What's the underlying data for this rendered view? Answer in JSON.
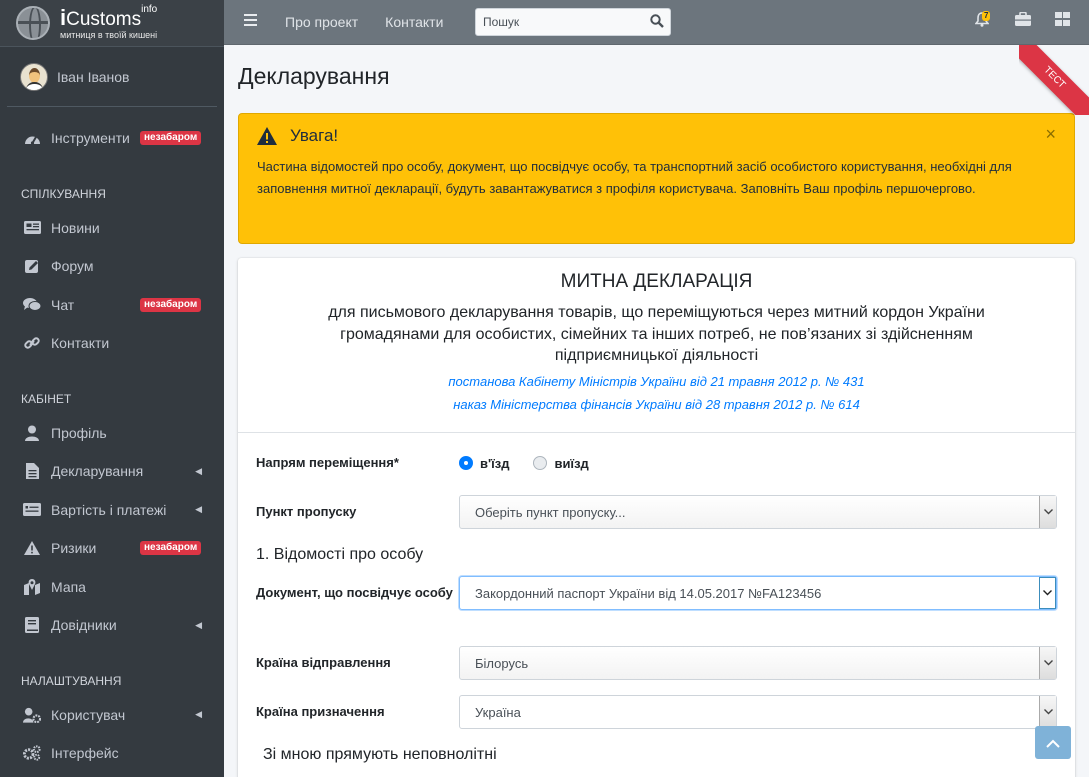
{
  "brand": {
    "logo_i": "i",
    "name": "Customs",
    "sup": "info",
    "tagline": "митниця в твоїй кишені"
  },
  "user": {
    "name": "Іван Іванов"
  },
  "sidebar": {
    "tools": {
      "label": "Інструменти",
      "badge": "незабаром",
      "icon": "tachometer-icon"
    },
    "section_communication": "СПІЛКУВАННЯ",
    "news": {
      "label": "Новини",
      "icon": "newspaper-icon"
    },
    "forum": {
      "label": "Форум",
      "icon": "edit-icon"
    },
    "chat": {
      "label": "Чат",
      "badge": "незабаром",
      "icon": "comments-icon"
    },
    "contacts": {
      "label": "Контакти",
      "icon": "link-icon"
    },
    "section_cabinet": "КАБІНЕТ",
    "profile": {
      "label": "Профіль",
      "icon": "user-icon"
    },
    "declaring": {
      "label": "Декларування",
      "icon": "file-icon"
    },
    "payments": {
      "label": "Вартість і платежі",
      "icon": "money-check-icon"
    },
    "risks": {
      "label": "Ризики",
      "badge": "незабаром",
      "icon": "warning-icon"
    },
    "map": {
      "label": "Мапа",
      "icon": "map-marker-icon"
    },
    "handbooks": {
      "label": "Довідники",
      "icon": "book-icon"
    },
    "section_settings": "НАЛАШТУВАННЯ",
    "user_settings": {
      "label": "Користувач",
      "icon": "user-cog-icon"
    },
    "interface": {
      "label": "Інтерфейс",
      "icon": "cogs-icon"
    }
  },
  "topbar": {
    "about": "Про проект",
    "contacts": "Контакти",
    "search_placeholder": "Пошук",
    "notification_count": "7"
  },
  "page": {
    "title": "Декларування",
    "ribbon": "ТЕСТ"
  },
  "alert": {
    "title": "Увага!",
    "text": "Частина відомостей про особу, документ, що посвідчує особу, та транспортний засіб особистого користування, необхідні для заповнення митної декларації, будуть завантажуватися з профіля користувача. Заповніть Ваш профіль першочергово.",
    "close": "×"
  },
  "declaration": {
    "title": "МИТНА ДЕКЛАРАЦІЯ",
    "subtitle": "для письмового декларування товарів, що переміщуються через митний кордон України громадянами для особистих, сімейних та інших потреб, не пов’язаних зі здійсненням підприємницької діяльності",
    "ref1": "постанова Кабінету Міністрів України від 21 травня 2012 р. № 431",
    "ref2": "наказ Міністерства фінансів України від 28 травня 2012 р. № 614"
  },
  "form": {
    "direction_label": "Напрям переміщення*",
    "direction_in": "в'їзд",
    "direction_out": "виїзд",
    "direction_selected": "в'їзд",
    "checkpoint_label": "Пункт пропуску",
    "checkpoint_value": "Оберіть пункт пропуску...",
    "section1": "1. Відомості про особу",
    "document_label": "Документ, що посвідчує особу",
    "document_value": "Закордонний паспорт України від 14.05.2017 №FA123456",
    "departure_label": "Країна відправлення",
    "departure_value": "Білорусь",
    "destination_label": "Країна призначення",
    "destination_value": "Україна",
    "minors_text": "Зі мною прямують неповнолітні"
  }
}
